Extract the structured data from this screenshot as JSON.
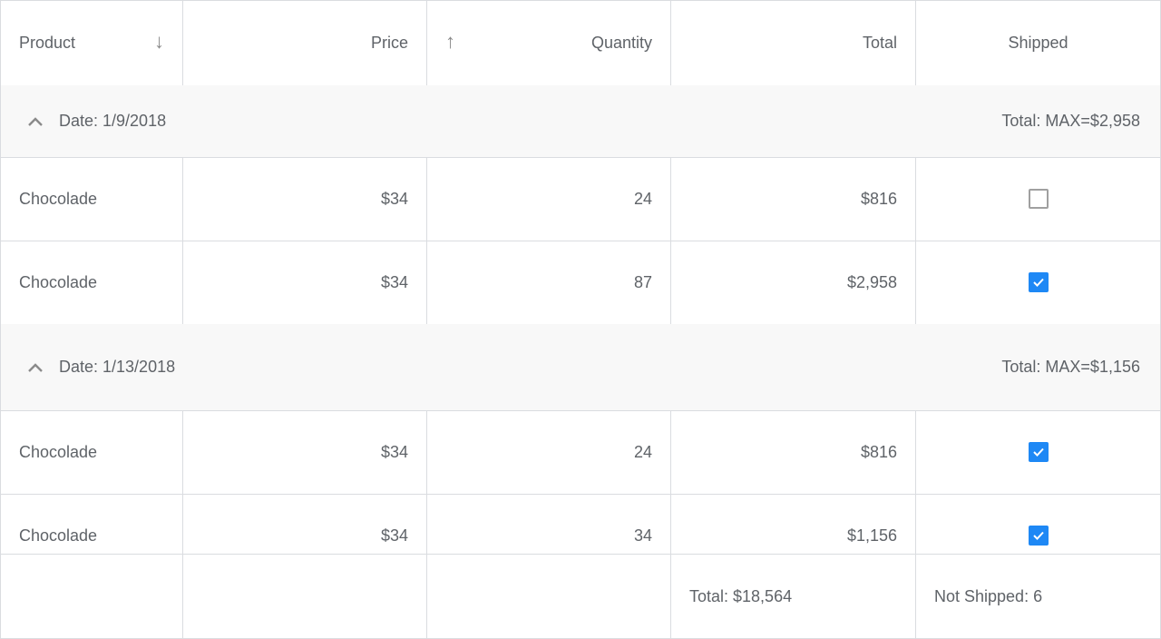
{
  "columns": [
    {
      "label": "Product",
      "sort": "descending",
      "sort_icon": "arrow-down-icon"
    },
    {
      "label": "Price"
    },
    {
      "label": "Quantity",
      "sort": "ascending",
      "sort_icon": "arrow-up-icon"
    },
    {
      "label": "Total"
    },
    {
      "label": "Shipped"
    }
  ],
  "groups": [
    {
      "label": "Date: 1/9/2018",
      "summary": "Total: MAX=$2,958",
      "expanded": true,
      "rows": [
        {
          "product": "Chocolade",
          "price": "$34",
          "quantity": "24",
          "total": "$816",
          "shipped": false
        },
        {
          "product": "Chocolade",
          "price": "$34",
          "quantity": "87",
          "total": "$2,958",
          "shipped": true
        }
      ]
    },
    {
      "label": "Date: 1/13/2018",
      "summary": "Total: MAX=$1,156",
      "expanded": true,
      "rows": [
        {
          "product": "Chocolade",
          "price": "$34",
          "quantity": "24",
          "total": "$816",
          "shipped": true
        },
        {
          "product": "Chocolade",
          "price": "$34",
          "quantity": "34",
          "total": "$1,156",
          "shipped": true
        }
      ]
    }
  ],
  "footer": {
    "total": "Total: $18,564",
    "shipped": "Not Shipped: 6"
  },
  "colors": {
    "checkbox_checked": "#1e88f5",
    "group_background": "#f8f8f8",
    "border": "#dadce0",
    "text": "#5f6368"
  }
}
